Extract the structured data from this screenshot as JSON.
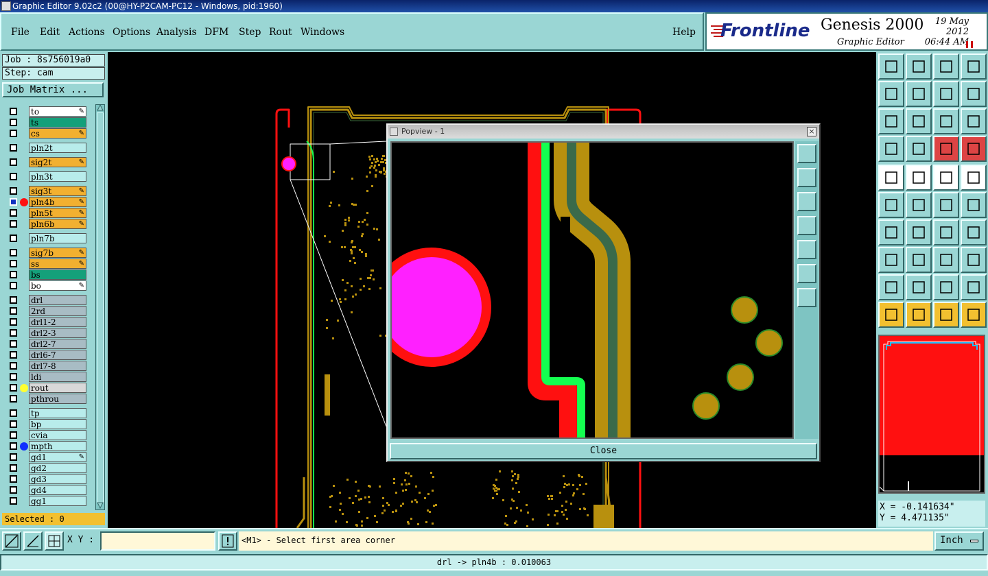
{
  "window": {
    "title": "Graphic Editor 9.02c2 (00@HY-P2CAM-PC12 - Windows, pid:1960)"
  },
  "menu": {
    "file": "File",
    "edit": "Edit",
    "actions": "Actions",
    "options": "Options",
    "analysis": "Analysis",
    "dfm": "DFM",
    "step": "Step",
    "rout": "Rout",
    "windows": "Windows",
    "help": "Help"
  },
  "logo": {
    "brand": "Frontline",
    "product": "Genesis 2000",
    "subtitle": "Graphic Editor",
    "date": "19 May 2012",
    "time": "06:44 AM"
  },
  "job": {
    "job_label": "Job : 8s756019a0",
    "step_label": "Step: cam",
    "matrix_button": "Job Matrix ..."
  },
  "layers": [
    {
      "name": "to",
      "color": "#ffffff",
      "dot": "",
      "pen": true
    },
    {
      "name": "ts",
      "color": "#14a07a",
      "dot": "",
      "pen": false
    },
    {
      "name": "cs",
      "color": "#f2b030",
      "dot": "",
      "pen": true
    },
    {
      "name": "pln2t",
      "color": "#b8eceb",
      "dot": "",
      "pen": false
    },
    {
      "name": "sig2t",
      "color": "#f2b030",
      "dot": "",
      "pen": true
    },
    {
      "name": "pln3t",
      "color": "#b8eceb",
      "dot": "",
      "pen": false
    },
    {
      "name": "sig3t",
      "color": "#f2b030",
      "dot": "",
      "pen": true
    },
    {
      "name": "pln4b",
      "color": "#f2b030",
      "dot": "#ff1010",
      "pen": true
    },
    {
      "name": "pln5t",
      "color": "#f2b030",
      "dot": "",
      "pen": true
    },
    {
      "name": "pln6b",
      "color": "#f2b030",
      "dot": "",
      "pen": true
    },
    {
      "name": "pln7b",
      "color": "#b8eceb",
      "dot": "",
      "pen": false
    },
    {
      "name": "sig7b",
      "color": "#f2b030",
      "dot": "",
      "pen": true
    },
    {
      "name": "ss",
      "color": "#f2b030",
      "dot": "",
      "pen": true
    },
    {
      "name": "bs",
      "color": "#14a07a",
      "dot": "",
      "pen": false
    },
    {
      "name": "bo",
      "color": "#ffffff",
      "dot": "",
      "pen": true
    },
    {
      "name": "drl",
      "color": "#a8bcc4",
      "dot": "",
      "pen": false
    },
    {
      "name": "2rd",
      "color": "#a8bcc4",
      "dot": "",
      "pen": false
    },
    {
      "name": "drl1-2",
      "color": "#a8bcc4",
      "dot": "",
      "pen": false
    },
    {
      "name": "drl2-3",
      "color": "#a8bcc4",
      "dot": "",
      "pen": false
    },
    {
      "name": "drl2-7",
      "color": "#a8bcc4",
      "dot": "",
      "pen": false
    },
    {
      "name": "drl6-7",
      "color": "#a8bcc4",
      "dot": "",
      "pen": false
    },
    {
      "name": "drl7-8",
      "color": "#a8bcc4",
      "dot": "",
      "pen": false
    },
    {
      "name": "ldi",
      "color": "#a8bcc4",
      "dot": "",
      "pen": false
    },
    {
      "name": "rout",
      "color": "#d8d8d8",
      "dot": "#ffff30",
      "pen": false
    },
    {
      "name": "pthrou",
      "color": "#a8bcc4",
      "dot": "",
      "pen": false
    },
    {
      "name": "tp",
      "color": "#b8eceb",
      "dot": "",
      "pen": false
    },
    {
      "name": "bp",
      "color": "#b8eceb",
      "dot": "",
      "pen": false
    },
    {
      "name": "cvia",
      "color": "#b8eceb",
      "dot": "",
      "pen": false
    },
    {
      "name": "mpth",
      "color": "#b8eceb",
      "dot": "#1030ff",
      "pen": false
    },
    {
      "name": "gd1",
      "color": "#b8eceb",
      "dot": "",
      "pen": true
    },
    {
      "name": "gd2",
      "color": "#b8eceb",
      "dot": "",
      "pen": false
    },
    {
      "name": "gd3",
      "color": "#b8eceb",
      "dot": "",
      "pen": false
    },
    {
      "name": "gd4",
      "color": "#b8eceb",
      "dot": "",
      "pen": false
    },
    {
      "name": "gg1",
      "color": "#b8eceb",
      "dot": "",
      "pen": false
    }
  ],
  "selected": "Selected : 0",
  "popview": {
    "title": "Popview - 1",
    "close_label": "Close"
  },
  "coords": {
    "x": "X = -0.141634\"",
    "y": "Y = 4.471135\""
  },
  "bottom": {
    "xy_label": "X Y :",
    "xy_value": "",
    "prompt": "<M1> - Select first area corner",
    "units": "Inch"
  },
  "status": "drl -> pln4b : 0.010063",
  "colors": {
    "bg": "#9ad6d4",
    "canvas": "#000000",
    "copper": "#b8900e",
    "green_trace": "#14ff50",
    "red_trace": "#ff1010",
    "magenta": "#ff20ff"
  }
}
